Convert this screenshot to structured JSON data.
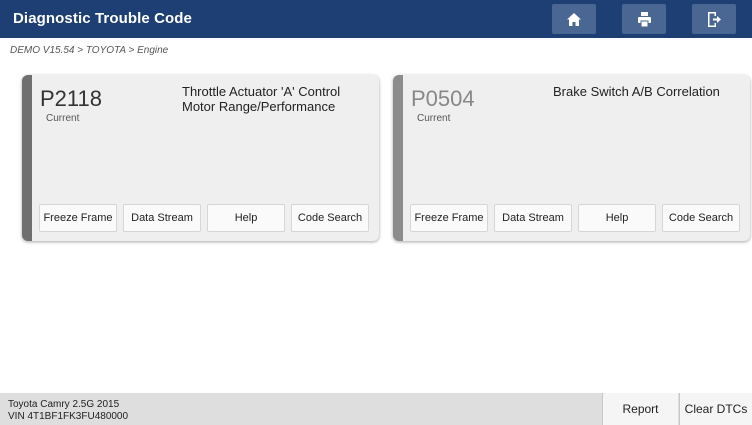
{
  "header": {
    "title": "Diagnostic Trouble Code",
    "buttons": [
      {
        "icon": "home-icon"
      },
      {
        "icon": "print-icon"
      },
      {
        "icon": "exit-icon"
      }
    ]
  },
  "breadcrumb": "DEMO V15.54 > TOYOTA > Engine",
  "colors": {
    "header_bg": "#1e3f73",
    "accent_active": "#6f6f6f",
    "accent_inactive": "#8c8c8c",
    "code_active": "#333333",
    "code_inactive": "#888888"
  },
  "dtcs": [
    {
      "code": "P2118",
      "status": "Current",
      "description_line1": "Throttle Actuator 'A' Control",
      "description_line2": "Motor Range/Performance",
      "buttons": [
        "Freeze Frame",
        "Data Stream",
        "Help",
        "Code Search"
      ]
    },
    {
      "code": "P0504",
      "status": "Current",
      "description_line1": "Brake Switch A/B Correlation",
      "description_line2": "",
      "buttons": [
        "Freeze Frame",
        "Data Stream",
        "Help",
        "Code Search"
      ]
    }
  ],
  "footer": {
    "vehicle": "Toyota Camry 2.5G 2015",
    "vin": "VIN 4T1BF1FK3FU480000",
    "report_label": "Report",
    "clear_label": "Clear DTCs"
  }
}
